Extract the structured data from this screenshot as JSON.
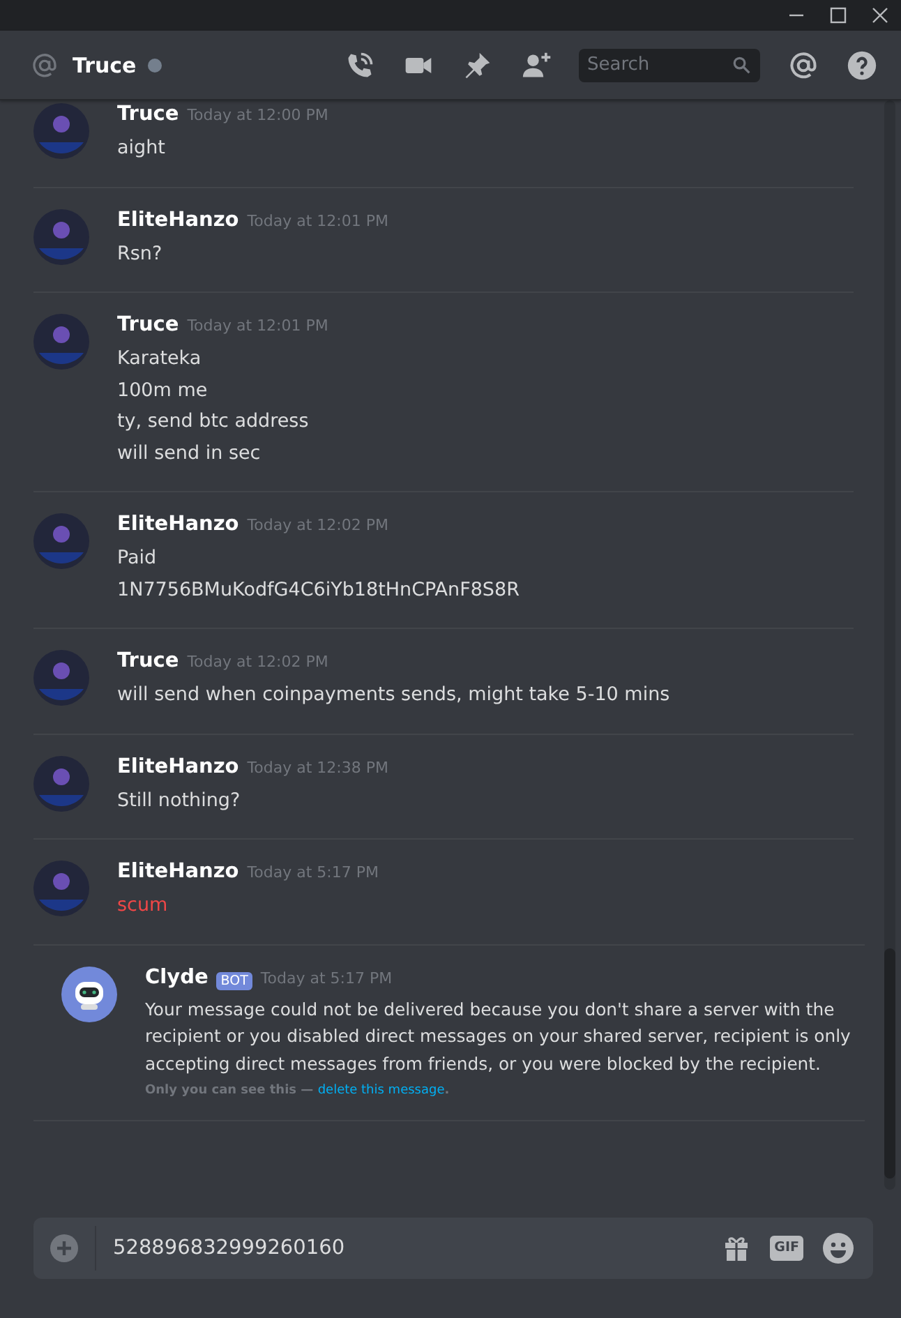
{
  "header": {
    "channel": "Truce",
    "online": false,
    "search": {
      "placeholder": "Search"
    }
  },
  "messages": [
    {
      "author": "Truce",
      "kind": "user",
      "timestamp": "Today at 12:00 PM",
      "lines": [
        {
          "text": "aight",
          "kind": "sent"
        }
      ]
    },
    {
      "author": "EliteHanzo",
      "kind": "user",
      "timestamp": "Today at 12:01 PM",
      "lines": [
        {
          "text": "Rsn?",
          "kind": "sent"
        }
      ]
    },
    {
      "author": "Truce",
      "kind": "user",
      "timestamp": "Today at 12:01 PM",
      "lines": [
        {
          "text": "Karateka",
          "kind": "sent"
        },
        {
          "text": "100m me",
          "kind": "sent"
        },
        {
          "text": "ty, send btc address",
          "kind": "sent"
        },
        {
          "text": "will send in sec",
          "kind": "sent"
        }
      ]
    },
    {
      "author": "EliteHanzo",
      "kind": "user",
      "timestamp": "Today at 12:02 PM",
      "lines": [
        {
          "text": "Paid",
          "kind": "sent"
        },
        {
          "text": "1N7756BMuKodfG4C6iYb18tHnCPAnF8S8R",
          "kind": "sent"
        }
      ]
    },
    {
      "author": "Truce",
      "kind": "user",
      "timestamp": "Today at 12:02 PM",
      "lines": [
        {
          "text": "will send when coinpayments sends, might take 5-10 mins",
          "kind": "sent"
        }
      ]
    },
    {
      "author": "EliteHanzo",
      "kind": "user",
      "timestamp": "Today at 12:38 PM",
      "lines": [
        {
          "text": "Still nothing?",
          "kind": "sent"
        }
      ]
    },
    {
      "author": "EliteHanzo",
      "kind": "user",
      "timestamp": "Today at 5:17 PM",
      "lines": [
        {
          "text": "scum",
          "kind": "failed"
        }
      ]
    },
    {
      "author": "Clyde",
      "kind": "bot",
      "badge": "BOT",
      "timestamp": "Today at 5:17 PM",
      "lines": [
        {
          "text": "Your message could not be delivered because you don't share a server with the recipient or you disabled direct messages on your shared server, recipient is only accepting direct messages from friends, or you were blocked by the recipient.",
          "kind": "sent"
        }
      ],
      "note": {
        "text": "Only you can see this — ",
        "link": "delete this message",
        "after": "."
      }
    }
  ],
  "composer": {
    "value": "528896832999260160",
    "gif_label": "GIF"
  }
}
